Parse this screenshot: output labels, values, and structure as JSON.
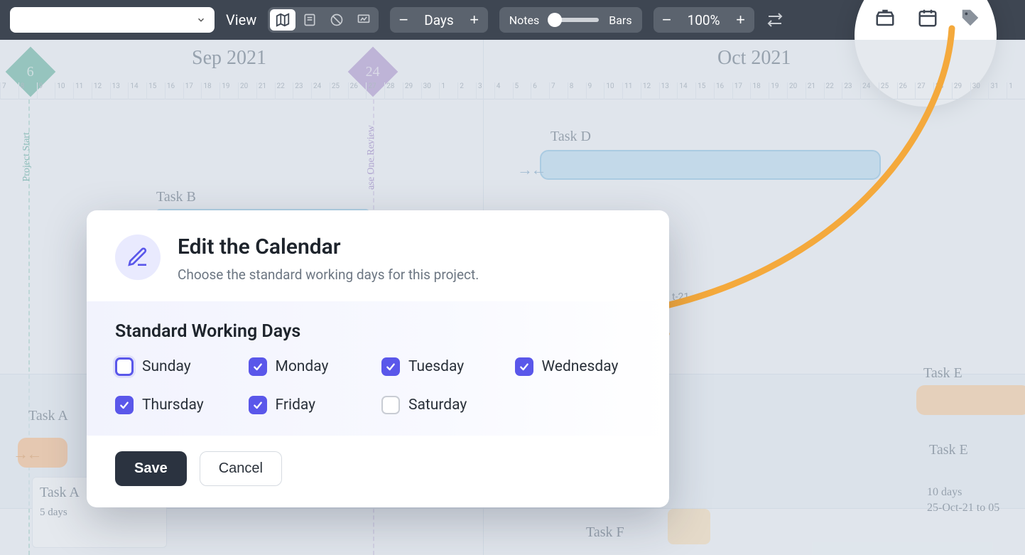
{
  "toolbar": {
    "view_label": "View",
    "unit_label": "Days",
    "slider_left": "Notes",
    "slider_right": "Bars",
    "zoom_pct": "100%"
  },
  "timeline": {
    "months": {
      "sep": "Sep 2021",
      "oct": "Oct 2021"
    },
    "milestones": {
      "m1": "6",
      "m2": "24"
    },
    "vlabels": {
      "start": "Project Start",
      "phase": "ase One Review"
    },
    "tasks": {
      "b": "Task B",
      "d": "Task D",
      "a": "Task A",
      "f": "Task F",
      "e_top": "Task E",
      "e_mid": "Task E"
    },
    "notes": {
      "a_dur": "5 days",
      "e_dur": "10 days",
      "e_dates": "25-Oct-21 to 05",
      "badge": "t-21"
    },
    "ticks": [
      "7",
      "8",
      "9",
      "10",
      "11",
      "12",
      "13",
      "14",
      "15",
      "16",
      "17",
      "18",
      "19",
      "20",
      "21",
      "22",
      "23",
      "24",
      "25",
      "26",
      "27",
      "28",
      "29",
      "30",
      "1",
      "2",
      "3",
      "4",
      "5",
      "6",
      "7",
      "8",
      "9",
      "10",
      "11",
      "12",
      "13",
      "14",
      "15",
      "16",
      "17",
      "18",
      "19",
      "20",
      "21",
      "22",
      "23",
      "24",
      "25",
      "26",
      "27",
      "28",
      "29",
      "30",
      "31",
      "1"
    ]
  },
  "dialog": {
    "title": "Edit the Calendar",
    "subtitle": "Choose the standard working days for this project.",
    "section": "Standard Working Days",
    "days": [
      {
        "label": "Sunday",
        "checked": false,
        "focused": true
      },
      {
        "label": "Monday",
        "checked": true,
        "focused": false
      },
      {
        "label": "Tuesday",
        "checked": true,
        "focused": false
      },
      {
        "label": "Wednesday",
        "checked": true,
        "focused": false
      },
      {
        "label": "Thursday",
        "checked": true,
        "focused": false
      },
      {
        "label": "Friday",
        "checked": true,
        "focused": false
      },
      {
        "label": "Saturday",
        "checked": false,
        "focused": false
      }
    ],
    "save": "Save",
    "cancel": "Cancel"
  }
}
